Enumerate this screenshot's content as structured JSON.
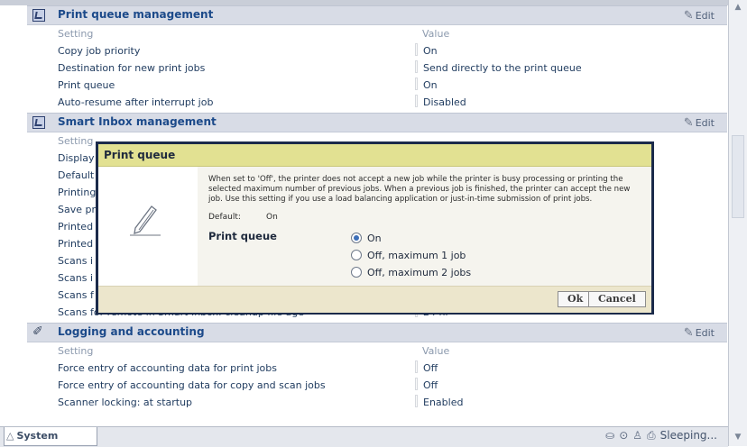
{
  "sections": {
    "print_queue_mgmt": {
      "title": "Print queue management",
      "edit": "Edit",
      "header": {
        "setting": "Setting",
        "value": "Value"
      },
      "rows": [
        {
          "setting": "Copy job priority",
          "value": "On"
        },
        {
          "setting": "Destination for new print jobs",
          "value": "Send directly to the print queue"
        },
        {
          "setting": "Print queue",
          "value": "On"
        },
        {
          "setting": "Auto-resume after interrupt job",
          "value": "Disabled"
        }
      ]
    },
    "smart_inbox_mgmt": {
      "title": "Smart Inbox management",
      "edit": "Edit",
      "header": {
        "setting": "Setting"
      },
      "rows": [
        {
          "setting": "Display"
        },
        {
          "setting": "Default"
        },
        {
          "setting": "Printing"
        },
        {
          "setting": "Save pr"
        },
        {
          "setting": "Printed"
        },
        {
          "setting": "Printed"
        },
        {
          "setting": "Scans i"
        },
        {
          "setting": "Scans i"
        },
        {
          "setting": "Scans f"
        },
        {
          "setting": "Scans for remote in Smart Inbox: cleanup file age",
          "value": "24 hr"
        }
      ]
    },
    "logging": {
      "title": "Logging and accounting",
      "edit": "Edit",
      "header": {
        "setting": "Setting",
        "value": "Value"
      },
      "rows": [
        {
          "setting": "Force entry of accounting data for print jobs",
          "value": "Off"
        },
        {
          "setting": "Force entry of accounting data for copy and scan jobs",
          "value": "Off"
        },
        {
          "setting": "Scanner locking: at startup",
          "value": "Enabled"
        }
      ]
    }
  },
  "dialog": {
    "title": "Print queue",
    "description": "When set to 'Off', the printer does not accept a new job while the printer is busy processing or printing the selected maximum number of previous jobs. When a previous job is finished, the printer can accept the new job. Use this setting if you use a load balancing application or just-in-time submission of print jobs.",
    "default_label": "Default:",
    "default_value": "On",
    "field_label": "Print queue",
    "options": [
      {
        "label": "On",
        "selected": true
      },
      {
        "label": "Off, maximum 1 job",
        "selected": false
      },
      {
        "label": "Off, maximum 2 jobs",
        "selected": false
      }
    ],
    "ok": "Ok",
    "cancel": "Cancel"
  },
  "statusbar": {
    "tab": "System",
    "status": "Sleeping..."
  },
  "colors": {
    "dialog_title_bg": "#e2e192",
    "section_title": "#1c4a8a",
    "dialog_border": "#1b2a4a"
  }
}
